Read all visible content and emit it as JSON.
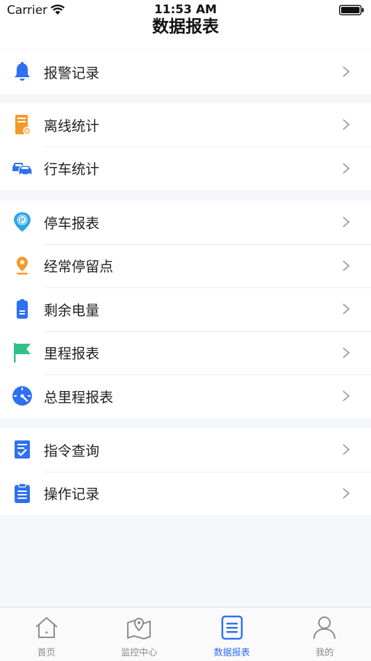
{
  "status_bar": {
    "carrier": "Carrier",
    "time": "11:53 AM"
  },
  "page_title": "数据报表",
  "groups": [
    {
      "items": [
        {
          "label": "报警记录",
          "icon": "bell-icon"
        }
      ]
    },
    {
      "items": [
        {
          "label": "离线统计",
          "icon": "offline-server-icon"
        },
        {
          "label": "行车统计",
          "icon": "cars-icon"
        }
      ]
    },
    {
      "items": [
        {
          "label": "停车报表",
          "icon": "parking-pin-icon"
        },
        {
          "label": "经常停留点",
          "icon": "location-pin-icon"
        },
        {
          "label": "剩余电量",
          "icon": "battery-icon"
        },
        {
          "label": "里程报表",
          "icon": "flag-icon"
        },
        {
          "label": "总里程报表",
          "icon": "speedometer-icon"
        }
      ]
    },
    {
      "items": [
        {
          "label": "指令查询",
          "icon": "command-checklist-icon"
        },
        {
          "label": "操作记录",
          "icon": "clipboard-icon"
        }
      ]
    }
  ],
  "tabbar": {
    "tabs": [
      {
        "label": "首页",
        "icon": "home-icon",
        "active": false
      },
      {
        "label": "监控中心",
        "icon": "map-pin-icon",
        "active": false
      },
      {
        "label": "数据报表",
        "icon": "report-icon",
        "active": true
      },
      {
        "label": "我的",
        "icon": "user-icon",
        "active": false
      }
    ]
  },
  "colors": {
    "accent": "#2f6ff2",
    "orange": "#f39a2b",
    "green": "#2ec28a",
    "inactive": "#8a8a8a"
  }
}
